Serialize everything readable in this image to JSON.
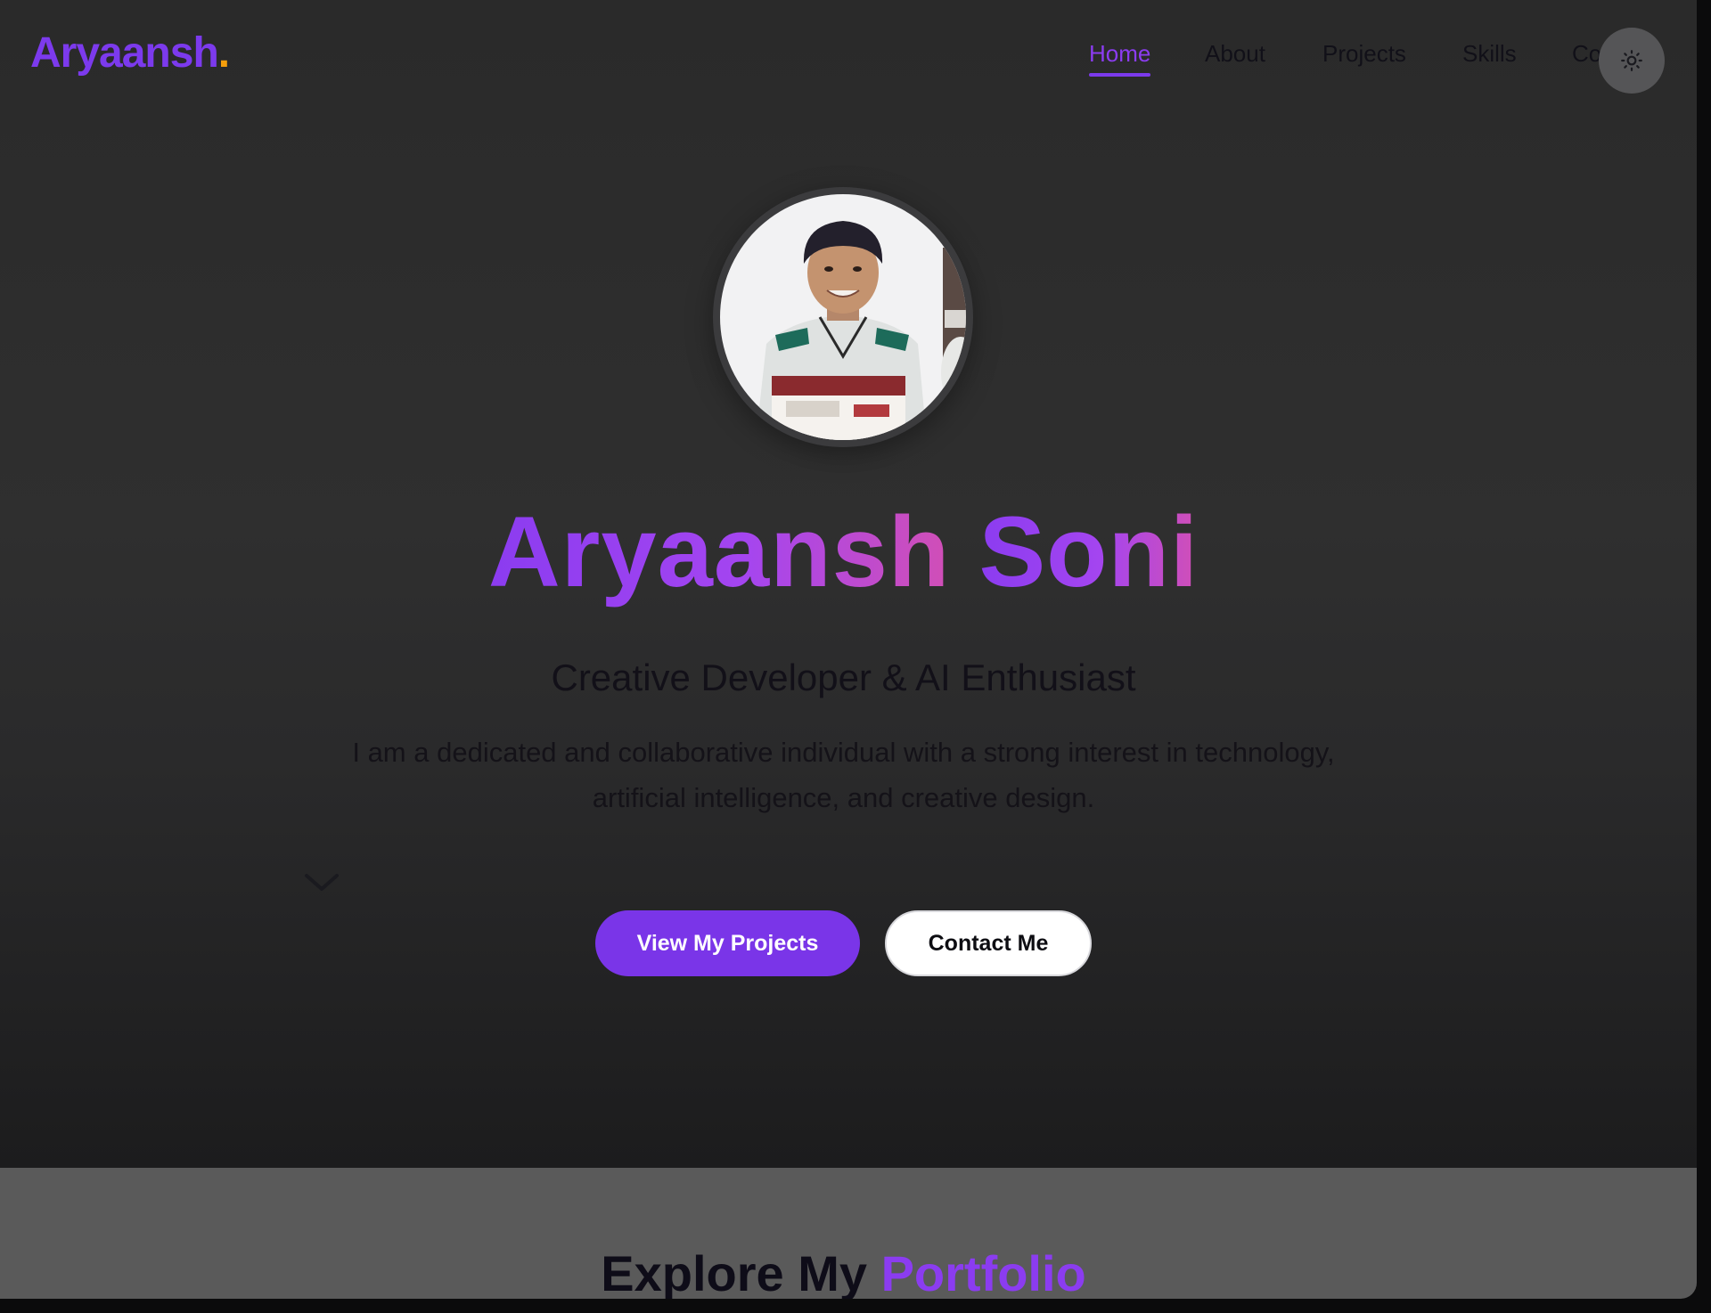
{
  "brand": {
    "name": "Aryaansh",
    "dot": ".",
    "accent_color": "#7c3aed",
    "dot_color": "#f59e0b"
  },
  "nav": {
    "items": [
      {
        "label": "Home",
        "active": true
      },
      {
        "label": "About",
        "active": false
      },
      {
        "label": "Projects",
        "active": false
      },
      {
        "label": "Skills",
        "active": false
      },
      {
        "label": "Co",
        "active": false
      }
    ],
    "theme_toggle_icon": "sun-icon"
  },
  "hero": {
    "avatar_alt": "profile-photo",
    "name_first": "Aryaansh",
    "name_last": "Soni",
    "tagline": "Creative Developer & AI Enthusiast",
    "bio": "I am a dedicated and collaborative individual with a strong interest in technology, artificial intelligence, and creative design.",
    "scroll_icon": "chevron-down-icon",
    "primary_button": "View My Projects",
    "secondary_button": "Contact Me"
  },
  "section": {
    "title_start": "Explore My",
    "title_accent": "Portfolio"
  }
}
